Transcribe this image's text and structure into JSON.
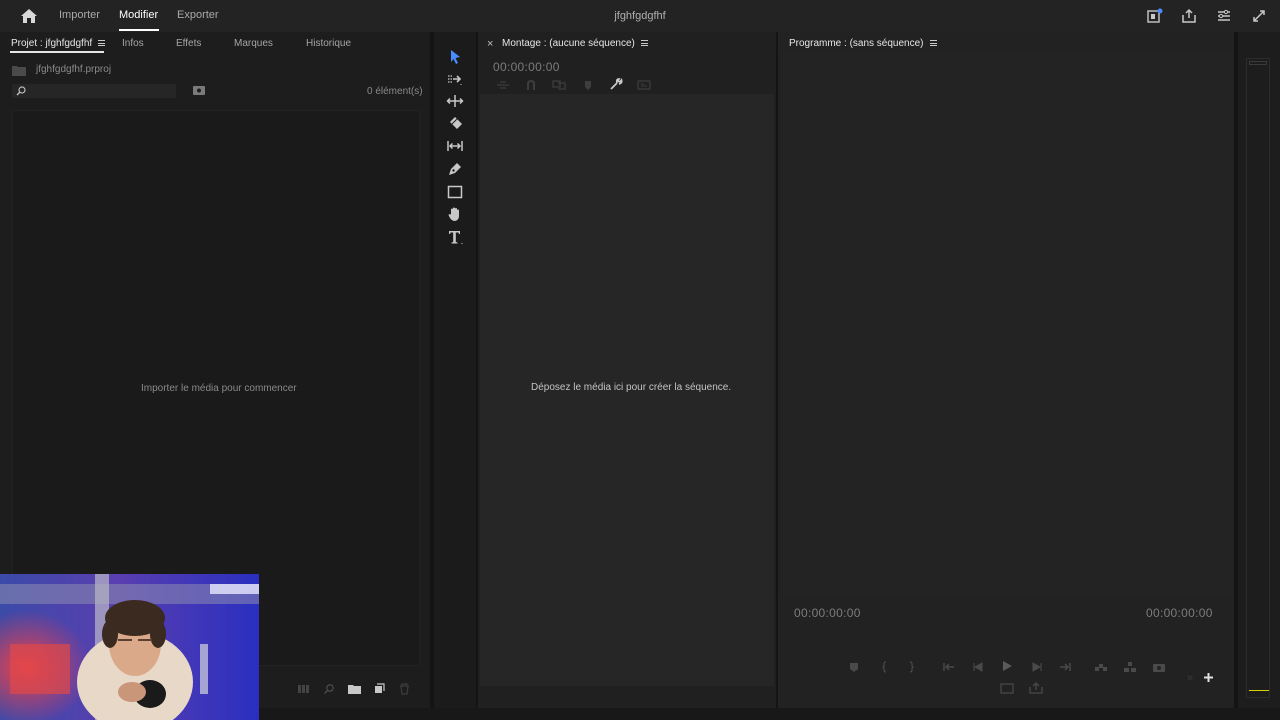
{
  "topbar": {
    "nav": [
      "Importer",
      "Modifier",
      "Exporter"
    ],
    "title": "jfghfgdgfhf"
  },
  "project_panel": {
    "tabs": [
      "Projet : jfghfgdgfhf",
      "Infos",
      "Effets",
      "Marques",
      "Historique"
    ],
    "file_name": "jfghfgdgfhf.prproj",
    "item_count": "0 élément(s)",
    "empty_message": "Importer le média pour commencer"
  },
  "timeline_panel": {
    "title": "Montage : (aucune séquence)",
    "close": "×",
    "timecode": "00:00:00:00",
    "empty_message": "Déposez le média ici pour créer la séquence."
  },
  "program_panel": {
    "title": "Programme : (sans séquence)",
    "timecode_left": "00:00:00:00",
    "timecode_right": "00:00:00:00"
  },
  "tools": [
    "selection-tool",
    "track-select-tool",
    "ripple-edit-tool",
    "razor-tool",
    "slip-tool",
    "pen-tool",
    "rectangle-tool",
    "hand-tool",
    "type-tool"
  ],
  "icons": {
    "home": "home-icon",
    "quick_export": "quick-export-icon",
    "share": "share-icon",
    "workspaces": "workspaces-icon",
    "fullscreen": "fullscreen-icon"
  },
  "colors": {
    "background": "#1e1e1e",
    "topbar": "#232323",
    "accent_active": "#ffffff",
    "tool_selected": "#4a8cff",
    "meter_mark": "#d8d000"
  }
}
